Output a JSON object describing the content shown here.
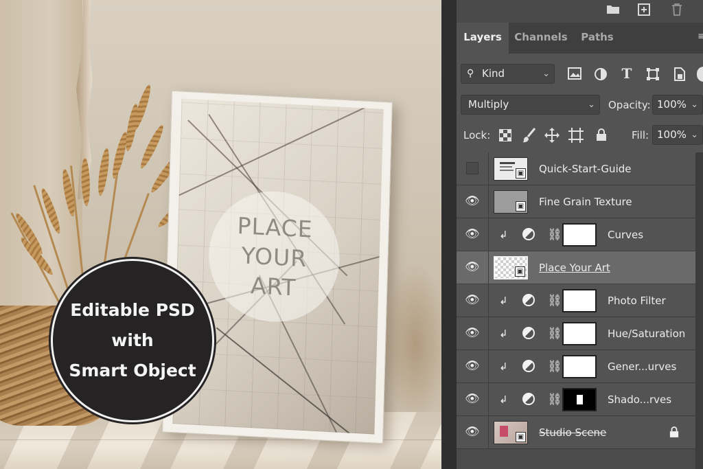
{
  "artwork": {
    "placeholder_lines": [
      "PLACE",
      "YOUR",
      "ART"
    ]
  },
  "badge": {
    "lines": [
      "Editable PSD",
      "with",
      "Smart Object"
    ]
  },
  "panel": {
    "top_icons": [
      "folder-icon",
      "new-layer-icon",
      "trash-icon"
    ],
    "tabs": [
      {
        "label": "Layers",
        "active": true
      },
      {
        "label": "Channels",
        "active": false
      },
      {
        "label": "Paths",
        "active": false
      }
    ],
    "filter": {
      "label": "Kind",
      "icons": [
        "image-filter-icon",
        "adjustment-filter-icon",
        "type-filter-icon",
        "shape-filter-icon",
        "smart-object-filter-icon"
      ]
    },
    "blend_mode": "Multiply",
    "opacity_label": "Opacity:",
    "opacity_value": "100%",
    "lock_label": "Lock:",
    "lock_icons": [
      "lock-transparent-icon",
      "lock-paint-icon",
      "lock-position-icon",
      "lock-artboard-icon",
      "lock-all-icon"
    ],
    "fill_label": "Fill:",
    "fill_value": "100%",
    "layers": [
      {
        "name": "Quick-Start-Guide",
        "visible": false,
        "kind": "smart-object"
      },
      {
        "name": "Fine Grain Texture",
        "visible": true,
        "kind": "smart-object"
      },
      {
        "name": "Curves",
        "visible": true,
        "kind": "adjustment",
        "clipped": true
      },
      {
        "name": "Place Your Art",
        "visible": true,
        "kind": "smart-object",
        "selected": true
      },
      {
        "name": "Photo Filter",
        "visible": true,
        "kind": "adjustment",
        "clipped": true
      },
      {
        "name": "Hue/Saturation",
        "visible": true,
        "kind": "adjustment",
        "clipped": true
      },
      {
        "name": "Gener...urves",
        "visible": true,
        "kind": "adjustment",
        "clipped": true
      },
      {
        "name": "Shado...rves",
        "visible": true,
        "kind": "adjustment",
        "clipped": true
      },
      {
        "name": "Studio Scene",
        "visible": true,
        "kind": "smart-object",
        "locked": true
      }
    ]
  },
  "colors": {
    "panel_bg": "#535353",
    "tab_bar_bg": "#3f3f3f",
    "selected_layer_bg": "#6a6a6a",
    "badge_bg": "#262324"
  }
}
